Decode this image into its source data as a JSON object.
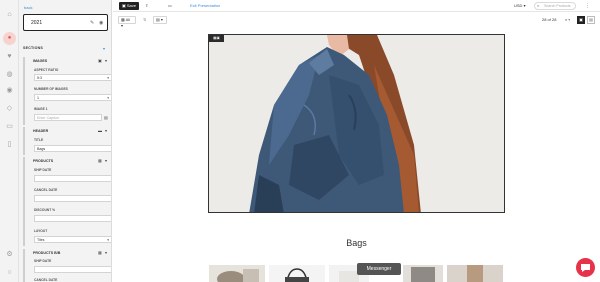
{
  "sidebar": {
    "back": "back",
    "title": "2021",
    "sections_label": "SECTIONS",
    "groups": {
      "images": {
        "header": "IMAGES",
        "aspect_ratio_label": "ASPECT RATIO",
        "aspect_ratio_value": "5:3",
        "number_label": "NUMBER OF IMAGES",
        "number_value": "1",
        "image1_label": "IMAGE 1",
        "caption_placeholder": "Enter Caption"
      },
      "header": {
        "header": "HEADER",
        "title_label": "TITLE",
        "title_value": "Bags"
      },
      "products": {
        "header": "PRODUCTS",
        "ship_date_label": "SHIP DATE",
        "cancel_date_label": "CANCEL DATE",
        "discount_label": "DISCOUNT %",
        "layout_label": "LAYOUT",
        "layout_value": "Tiles"
      },
      "products_bb": {
        "header": "PRODUCTS B/B",
        "ship_date_label": "SHIP DATE",
        "cancel_date_label": "CANCEL DATE"
      }
    }
  },
  "toolbar": {
    "save": "Save",
    "share": "Share",
    "pdf": "PDF",
    "exit": "Exit Presentation",
    "currency": "USD",
    "search_placeholder": "Search Products"
  },
  "subbar": {
    "filter": "All",
    "page_indicator": "28 of 28"
  },
  "canvas": {
    "slide_title": "Bags",
    "messenger": "Messenger"
  },
  "colors": {
    "accent": "#3c8dd8",
    "chat": "#e6334a",
    "dark": "#222222"
  }
}
